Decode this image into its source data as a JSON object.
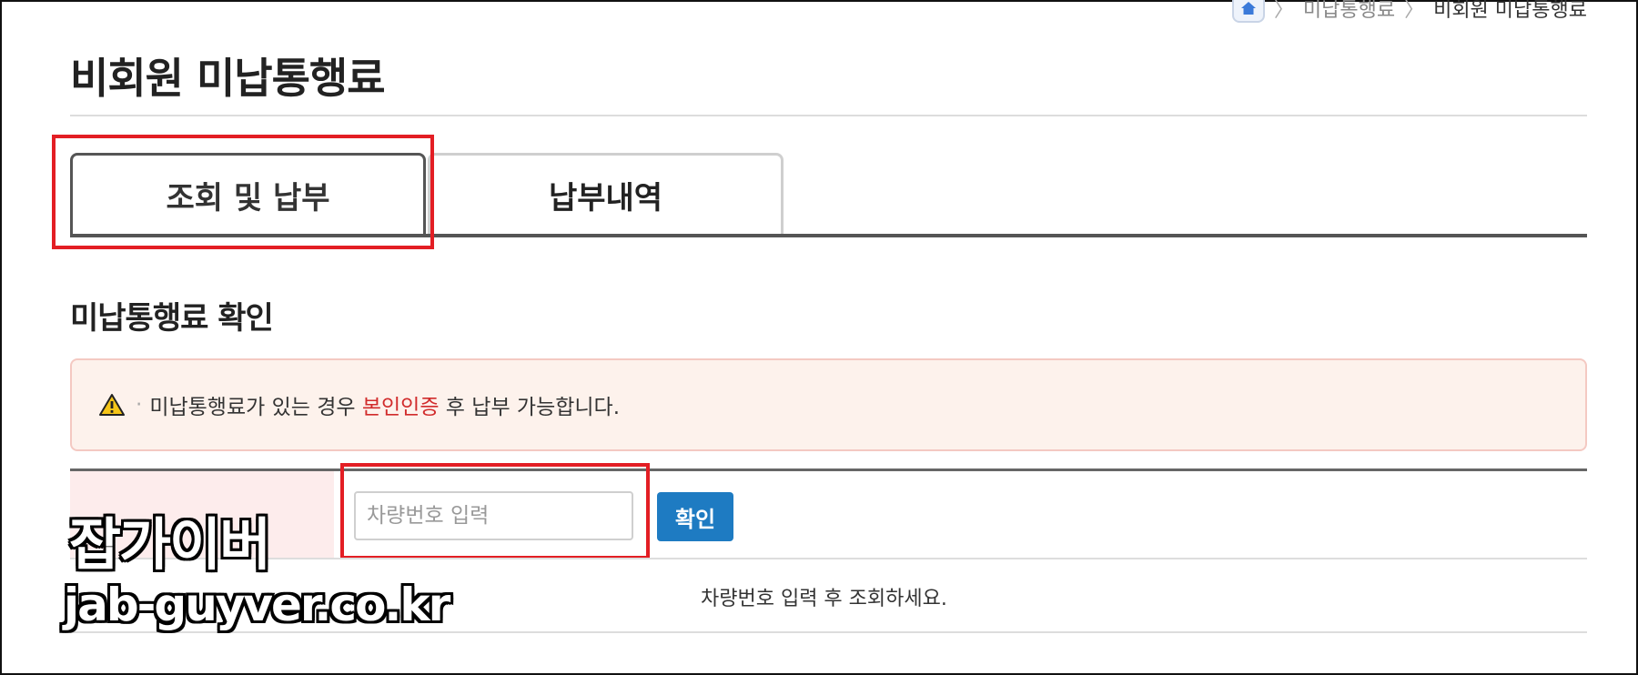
{
  "breadcrumb": {
    "home_icon": "home-icon",
    "items": [
      "미납통행료",
      "비회원 미납통행료"
    ]
  },
  "page": {
    "title": "비회원 미납통행료"
  },
  "tabs": [
    {
      "label": "조회 및 납부",
      "active": true
    },
    {
      "label": "납부내역",
      "active": false
    }
  ],
  "section": {
    "title": "미납통행료 확인"
  },
  "notice": {
    "icon": "warning-icon",
    "text_before": "미납통행료가 있는 경우 ",
    "highlight": "본인인증",
    "text_after": " 후 납부 가능합니다."
  },
  "form": {
    "plate_placeholder": "차량번호 입력",
    "plate_value": "",
    "confirm_label": "확인",
    "result_message": "차량번호 입력 후 조회하세요."
  },
  "watermark": {
    "title": "잡가이버",
    "url": "jab-guyver.co.kr"
  },
  "colors": {
    "highlight_border": "#e31e24",
    "confirm_button": "#1e7bc2",
    "notice_background": "#fdf2ec",
    "notice_highlight": "#d12b2b"
  }
}
